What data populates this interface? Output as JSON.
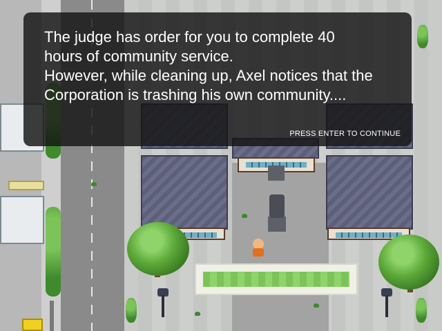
{
  "dialog": {
    "lines": [
      "The judge has order for you to complete 40",
      "hours of community service.",
      "However, while cleaning up, Axel notices that the",
      "Corporation is trashing his own community...."
    ],
    "prompt": "PRESS ENTER TO CONTINUE"
  },
  "scene": {
    "description_icons": [
      "statue-icon",
      "tree-icon",
      "lamp-icon",
      "trash-icon"
    ]
  }
}
